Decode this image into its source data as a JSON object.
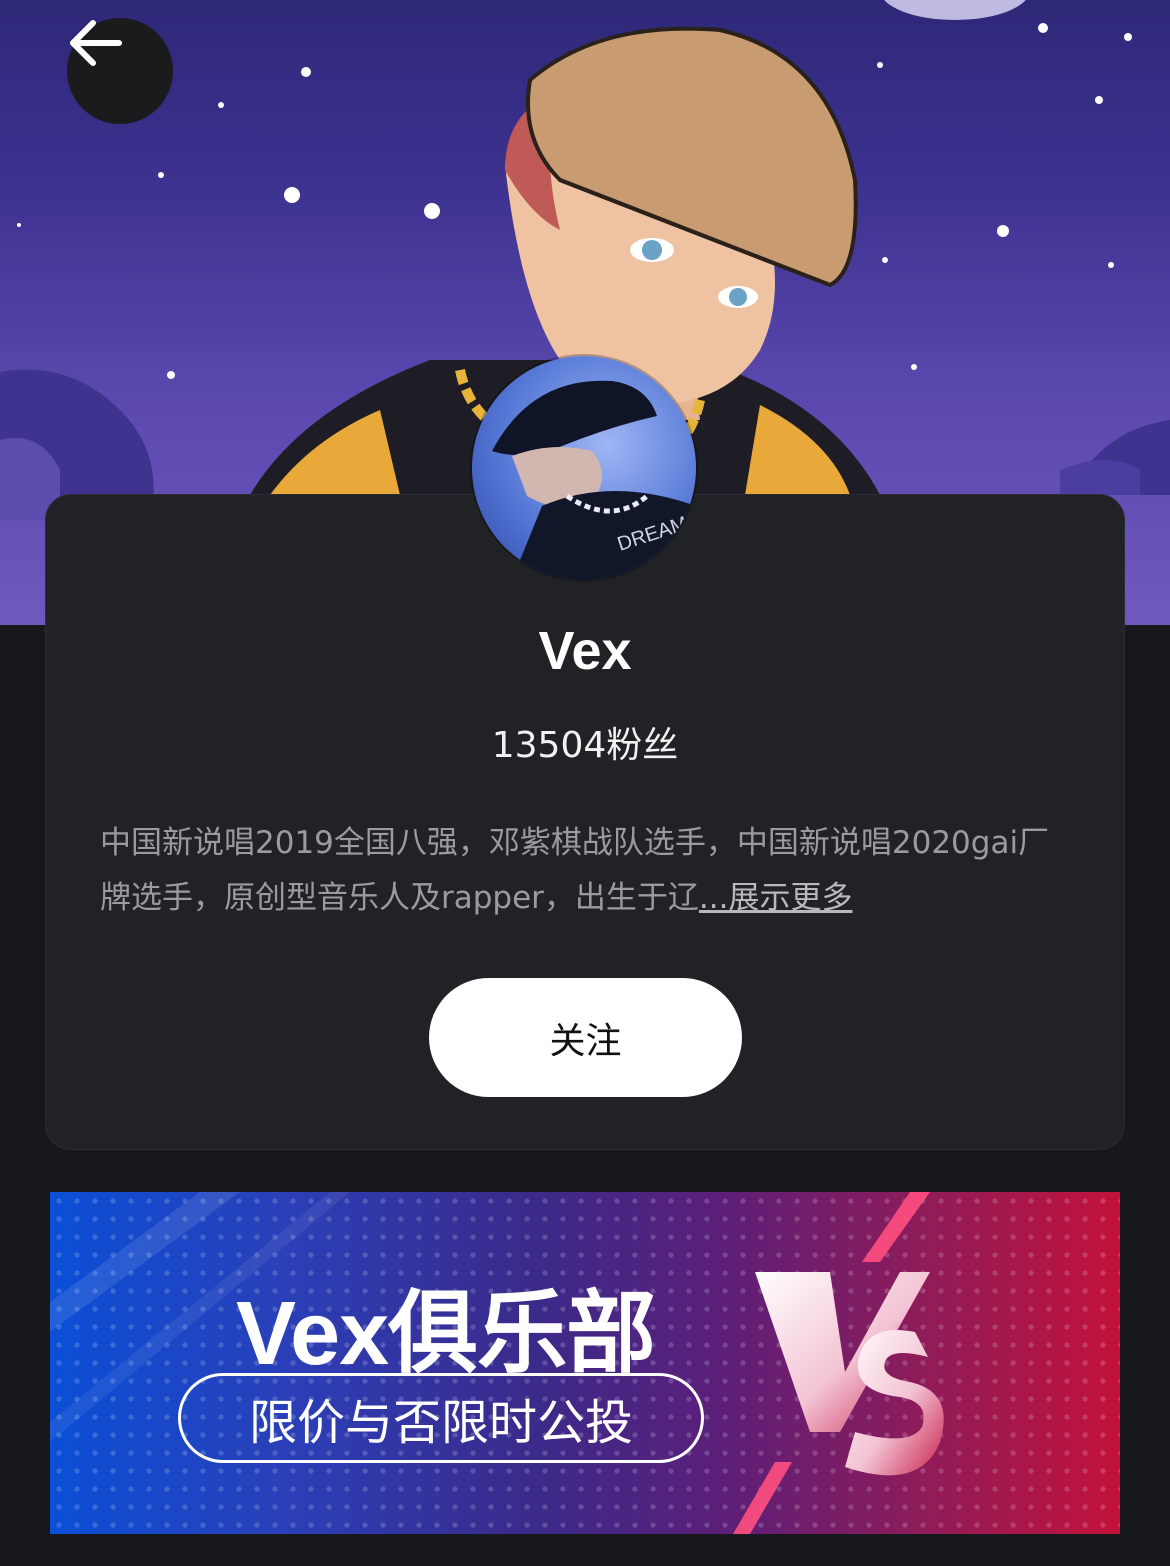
{
  "artist": {
    "name": "Vex",
    "fans": "13504粉丝",
    "bio": "中国新说唱2019全国八强，邓紫棋战队选手，中国新说唱2020gai厂牌选手，原创型音乐人及rapper，出生于辽",
    "more_label": "...展示更多"
  },
  "actions": {
    "follow_label": "关注"
  },
  "banner": {
    "title": "Vex俱乐部",
    "subtitle": "限价与否限时公投",
    "vs_text": "VS"
  },
  "icons": {
    "back": "arrow-left-icon"
  },
  "colors": {
    "page_bg": "#17181c",
    "card_bg": "#212226",
    "follow_bg": "#ffffff",
    "banner_left": "#0a4fd6",
    "banner_right": "#c3123a"
  }
}
